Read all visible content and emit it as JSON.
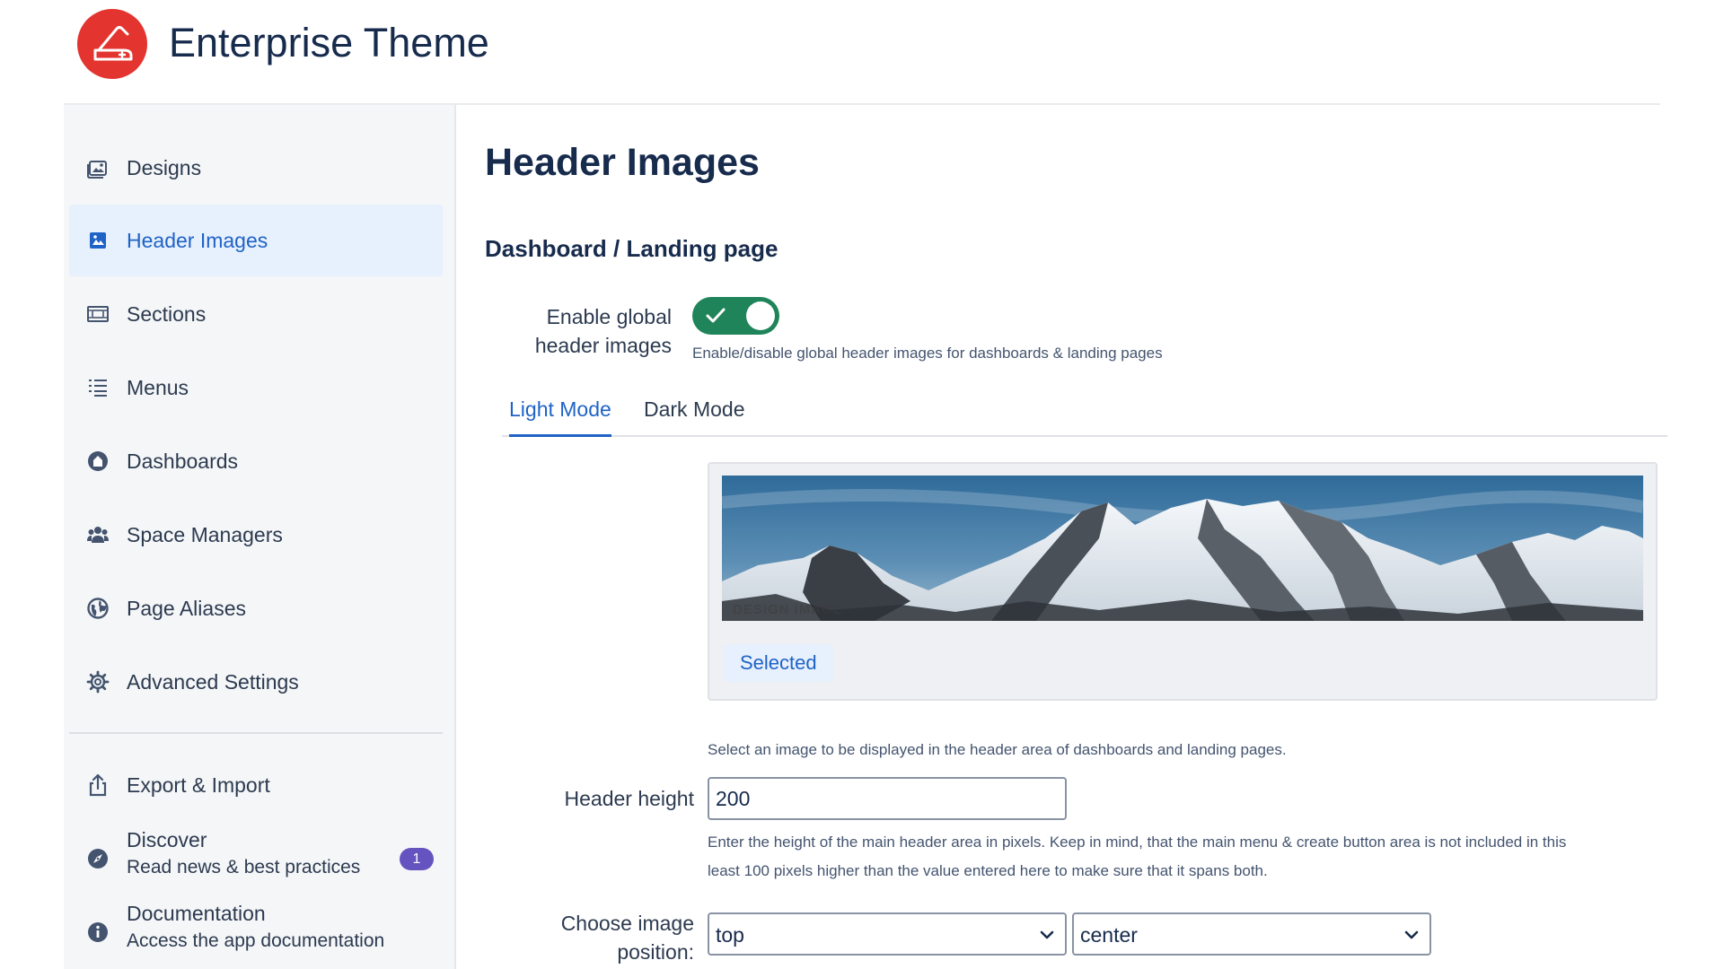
{
  "app": {
    "title": "Enterprise Theme",
    "brand_color": "#e3342f",
    "logo_icon": "knife-icon"
  },
  "sidebar": {
    "items": [
      {
        "label": "Designs",
        "icon": "designs-icon"
      },
      {
        "label": "Header Images",
        "icon": "image-icon",
        "active": true
      },
      {
        "label": "Sections",
        "icon": "sections-icon"
      },
      {
        "label": "Menus",
        "icon": "menu-list-icon"
      },
      {
        "label": "Dashboards",
        "icon": "dashboard-icon"
      },
      {
        "label": "Space Managers",
        "icon": "users-icon"
      },
      {
        "label": "Page Aliases",
        "icon": "globe-icon"
      },
      {
        "label": "Advanced Settings",
        "icon": "gear-icon"
      }
    ],
    "secondary": [
      {
        "label": "Export & Import",
        "icon": "export-icon"
      },
      {
        "label": "Discover",
        "sublabel": "Read news & best practices",
        "icon": "compass-icon",
        "badge": "1"
      },
      {
        "label": "Documentation",
        "sublabel": "Access the app documentation",
        "icon": "info-icon"
      }
    ],
    "accent_color": "#1f63c6",
    "badge_color": "#6554c0"
  },
  "main": {
    "page_title": "Header Images",
    "section_title": "Dashboard / Landing page",
    "toggle": {
      "label": "Enable global header images",
      "label_line1": "Enable global",
      "label_line2": "header images",
      "enabled": true,
      "help": "Enable/disable global header images for dashboards & landing pages",
      "color": "#1f845a"
    },
    "tabs": [
      {
        "label": "Light Mode",
        "active": true
      },
      {
        "label": "Dark Mode",
        "active": false
      }
    ],
    "image_card": {
      "caption": "DESIGN IMAGE",
      "selected_label": "Selected"
    },
    "image_help": "Select an image to be displayed in the header area of dashboards and landing pages.",
    "header_height": {
      "label": "Header height",
      "value": "200",
      "help_line1": "Enter the height of the main header area in pixels. Keep in mind, that the main menu & create button area is not included in this",
      "help_line2": "least 100 pixels higher than the value entered here to make sure that it spans both."
    },
    "image_position": {
      "label_line1": "Choose image",
      "label_line2": "position:",
      "vertical": "top",
      "horizontal": "center"
    }
  }
}
